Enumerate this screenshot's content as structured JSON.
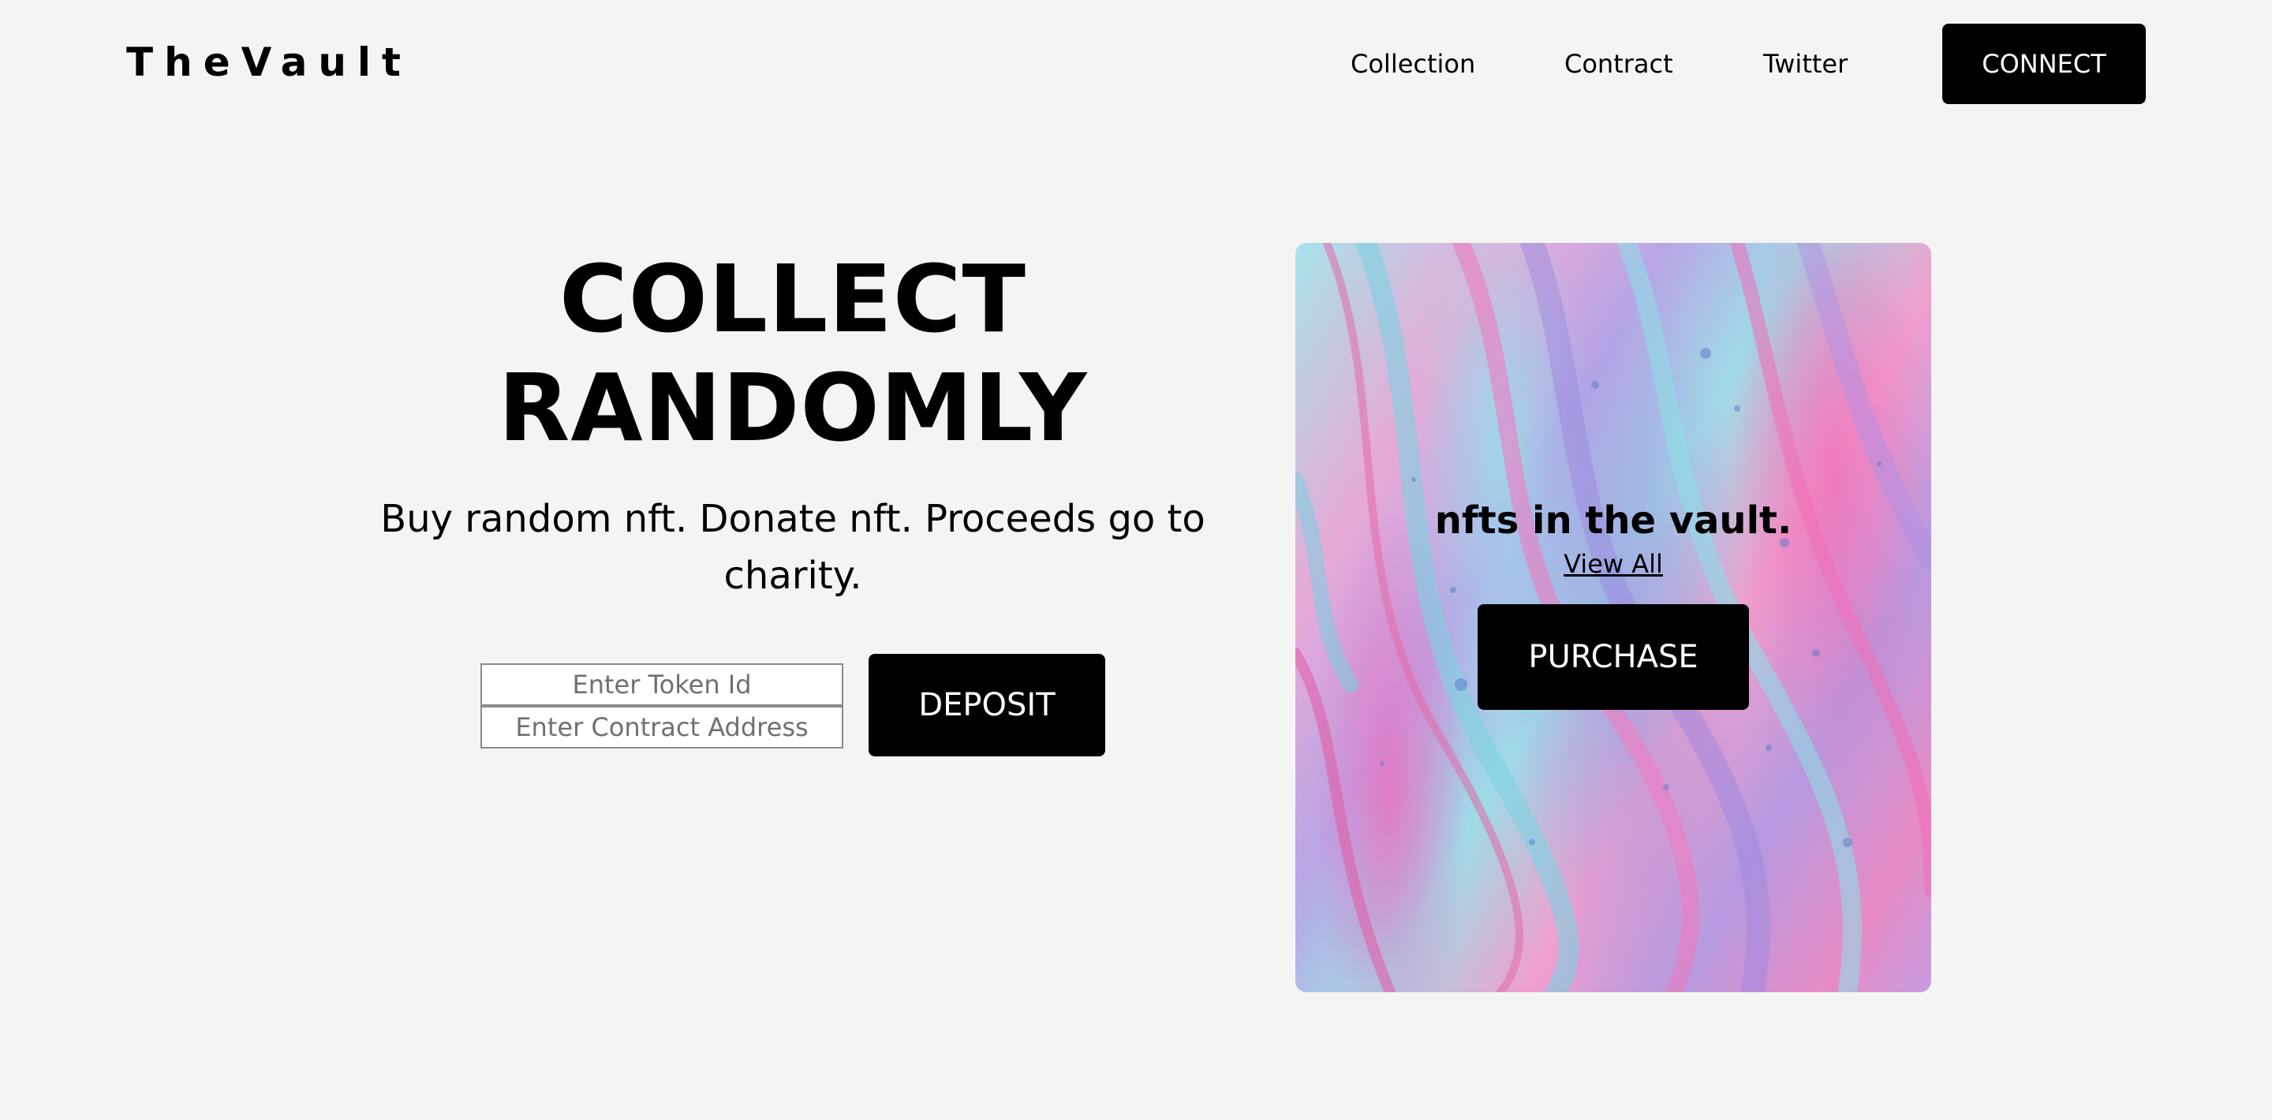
{
  "header": {
    "logo": "TheVault",
    "nav": [
      {
        "label": "Collection"
      },
      {
        "label": "Contract"
      },
      {
        "label": "Twitter"
      }
    ],
    "connect_label": "CONNECT"
  },
  "hero": {
    "title_line1": "COLLECT",
    "title_line2": "RANDOMLY",
    "subtitle": "Buy random nft. Donate nft. Proceeds go to charity.",
    "token_placeholder": "Enter Token Id",
    "contract_placeholder": "Enter Contract Address",
    "deposit_label": "DEPOSIT"
  },
  "vault_card": {
    "count_text": "nfts in the vault.",
    "view_all_label": "View All",
    "purchase_label": "PURCHASE"
  },
  "colors": {
    "background": "#f4f4f4",
    "button_bg": "#000000",
    "button_text": "#ffffff"
  }
}
